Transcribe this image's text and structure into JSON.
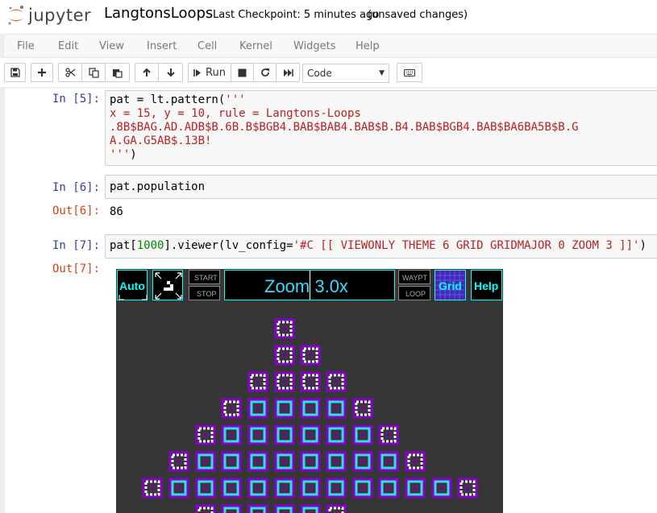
{
  "header": {
    "logo_text": "jupyter",
    "notebook_name": "LangtonsLoops",
    "checkpoint": "Last Checkpoint: 5 minutes ago",
    "autosave": "(unsaved changes)"
  },
  "menu": [
    "File",
    "Edit",
    "View",
    "Insert",
    "Cell",
    "Kernel",
    "Widgets",
    "Help"
  ],
  "toolbar": {
    "run_label": "Run",
    "cell_type": "Code",
    "icons": [
      "save-icon",
      "plus-icon",
      "cut-icon",
      "copy-icon",
      "paste-icon",
      "arrow-up-icon",
      "arrow-down-icon",
      "step-forward-icon",
      "stop-icon",
      "restart-icon",
      "fast-forward-icon",
      "keyboard-icon"
    ]
  },
  "cells": [
    {
      "in_prompt": "In [5]:",
      "code_lines": [
        {
          "a": "pat = lt.pattern(",
          "b": "'''"
        },
        {
          "s": "x = 15, y = 10, rule = Langtons-Loops"
        },
        {
          "s": ".8B$BAG.AD.ADB$B.6B.B$BGB4.BAB$BAB4.BAB$B.B4.BAB$BGB4.BAB$BA6BA5B$B.G"
        },
        {
          "s": "A.GA.G5AB$.13B!"
        },
        {
          "a": "",
          "b": "'''",
          "c": ")"
        }
      ]
    },
    {
      "in_prompt": "In [6]:",
      "code": "pat.population",
      "out_prompt": "Out[6]:",
      "output": "86"
    },
    {
      "in_prompt": "In [7]:",
      "code_pre": "pat[",
      "code_num": "1000",
      "code_mid": "].viewer(lv_config=",
      "code_str": "'#C [[ VIEWONLY THEME 6 GRID GRIDMAJOR 0 ZOOM 3 ]]'",
      "code_post": ")",
      "out_prompt": "Out[7]:"
    }
  ],
  "viewer": {
    "auto_label": "Auto",
    "start_label": "START",
    "stop_label": "STOP",
    "zoom_label": "Zoom 3.0x",
    "waypt_label": "WAYPT",
    "loop_label": "LOOP",
    "grid_label": "Grid",
    "help_label": "Help",
    "colors": {
      "background": "#363636",
      "accent": "#00ffff",
      "purple": "#8800cc",
      "cyan": "#33ddee",
      "white": "#ffffff"
    }
  }
}
